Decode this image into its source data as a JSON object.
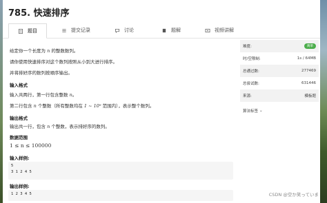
{
  "title": "785. 快速排序",
  "tabs": [
    {
      "label": "题目",
      "icon": "document-icon",
      "active": true
    },
    {
      "label": "提交记录",
      "icon": "list-icon",
      "active": false
    },
    {
      "label": "讨论",
      "icon": "chat-icon",
      "active": false
    },
    {
      "label": "题解",
      "icon": "book-icon",
      "active": false
    },
    {
      "label": "视频讲解",
      "icon": "video-icon",
      "active": false
    }
  ],
  "problem": {
    "line1_a": "给定你一个长度为",
    "line1_n": "n",
    "line1_b": "的整数数列。",
    "line2": "请你使用快速排序对这个数列按照从小到大进行排序。",
    "line3": "并将排好序的数列按顺序输出。",
    "input_title": "输入格式",
    "input_line1_a": "输入共两行，第一行包含整数",
    "input_line1_n": "n",
    "input_line1_b": "。",
    "input_line2_a": "第二行包含",
    "input_line2_n": "n",
    "input_line2_b": "个整数（所有整数均在",
    "input_line2_range": "1 ~ 10⁹",
    "input_line2_c": "范围内），表示整个数列。",
    "output_title": "输出格式",
    "output_line_a": "输出共一行，包含",
    "output_line_n": "n",
    "output_line_b": "个整数，表示排好序的数列。",
    "range_title": "数据范围",
    "range_value": "1 ≤ n ≤ 100000",
    "sample_input_title": "输入样例:",
    "sample_input_line1": "5",
    "sample_input_line2": "3 1 2 4 5",
    "sample_output_title": "输出样例:",
    "sample_output_line1": "1 2 3 4 5"
  },
  "sidebar": {
    "difficulty_label": "难度:",
    "difficulty_value": "简单",
    "time_label": "时/空限制:",
    "time_value": "1s / 64MB",
    "pass_label": "总通过数:",
    "pass_value": "277469",
    "try_label": "总尝试数:",
    "try_value": "631446",
    "source_label": "来源:",
    "source_value": "模板题",
    "tags_label": "算法标签",
    "tags_toggle": "⌄"
  },
  "watermark": "CSDN @空か笑っていま",
  "colors": {
    "badge": "#4cae4c",
    "codebox": "#f5f5f5"
  }
}
